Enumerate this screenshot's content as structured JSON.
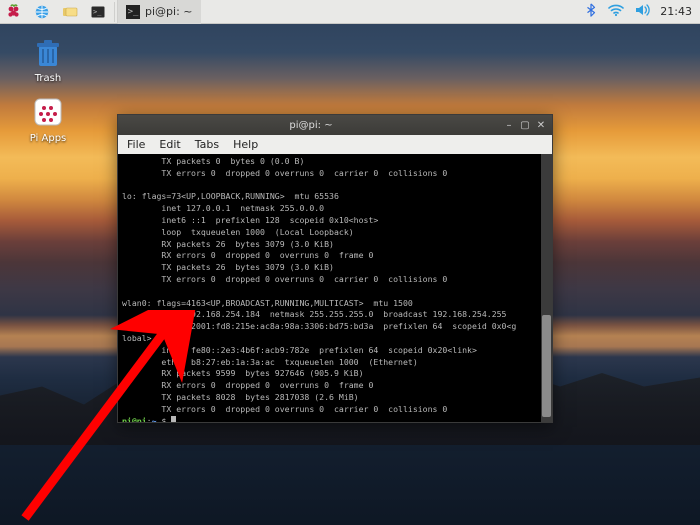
{
  "panel": {
    "task_label": "pi@pi: ~",
    "clock": "21:43"
  },
  "desktop": {
    "trash_label": "Trash",
    "piapps_label": "Pi Apps"
  },
  "terminal": {
    "title": "pi@pi: ~",
    "menu": {
      "file": "File",
      "edit": "Edit",
      "tabs": "Tabs",
      "help": "Help"
    },
    "output": "        TX packets 0  bytes 0 (0.0 B)\n        TX errors 0  dropped 0 overruns 0  carrier 0  collisions 0\n\nlo: flags=73<UP,LOOPBACK,RUNNING>  mtu 65536\n        inet 127.0.0.1  netmask 255.0.0.0\n        inet6 ::1  prefixlen 128  scopeid 0x10<host>\n        loop  txqueuelen 1000  (Local Loopback)\n        RX packets 26  bytes 3079 (3.0 KiB)\n        RX errors 0  dropped 0  overruns 0  frame 0\n        TX packets 26  bytes 3079 (3.0 KiB)\n        TX errors 0  dropped 0 overruns 0  carrier 0  collisions 0\n\nwlan0: flags=4163<UP,BROADCAST,RUNNING,MULTICAST>  mtu 1500\n        inet 192.168.254.184  netmask 255.255.255.0  broadcast 192.168.254.255\n        inet6 2001:fd8:215e:ac8a:98a:3306:bd75:bd3a  prefixlen 64  scopeid 0x0<g\nlobal>\n        inet6 fe80::2e3:4b6f:acb9:782e  prefixlen 64  scopeid 0x20<link>\n        ether b8:27:eb:1a:3a:ac  txqueuelen 1000  (Ethernet)\n        RX packets 9599  bytes 927646 (905.9 KiB)\n        RX errors 0  dropped 0  overruns 0  frame 0\n        TX packets 8028  bytes 2817038 (2.6 MiB)\n        TX errors 0  dropped 0 overruns 0  carrier 0  collisions 0\n",
    "prompt_user": "pi@pi",
    "prompt_path": "~",
    "prompt_sym": "$"
  }
}
